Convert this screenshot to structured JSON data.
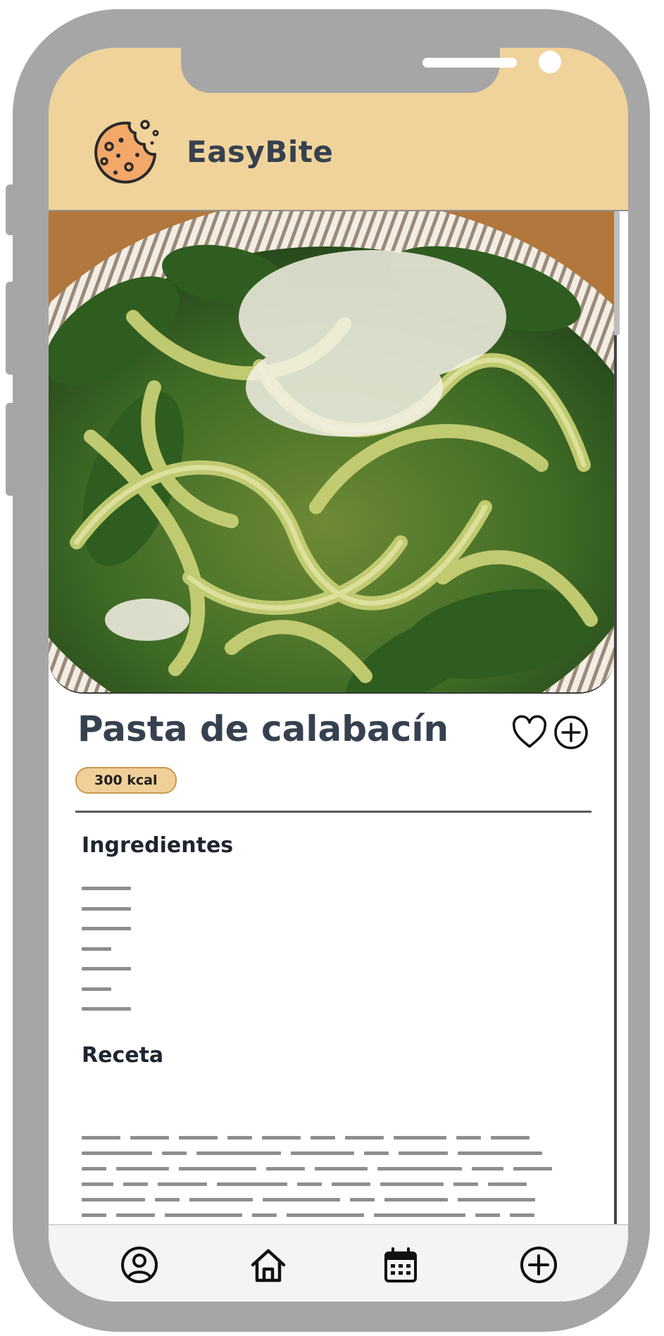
{
  "app": {
    "name": "EasyBite"
  },
  "colors": {
    "header_bg": "#f0d39b",
    "text_dark": "#36414f",
    "badge_bg": "#f0cf98",
    "device_frame": "#a6a6a6",
    "logo_cookie": "#f2a869"
  },
  "icons": {
    "logo": "cookie-icon",
    "favorite": "heart-icon",
    "add": "plus-circle-icon"
  },
  "recipe": {
    "title": "Pasta de calabacín",
    "calories": "300 kcal",
    "image": "zucchini-noodles-spinach-parmesan-photo"
  },
  "sections": {
    "ingredients_heading": "Ingredientes",
    "recipe_heading": "Receta"
  },
  "tabbar": [
    {
      "id": "profile",
      "icon": "user-circle-icon"
    },
    {
      "id": "home",
      "icon": "home-icon"
    },
    {
      "id": "calendar",
      "icon": "calendar-icon"
    },
    {
      "id": "add",
      "icon": "plus-circle-icon"
    }
  ]
}
